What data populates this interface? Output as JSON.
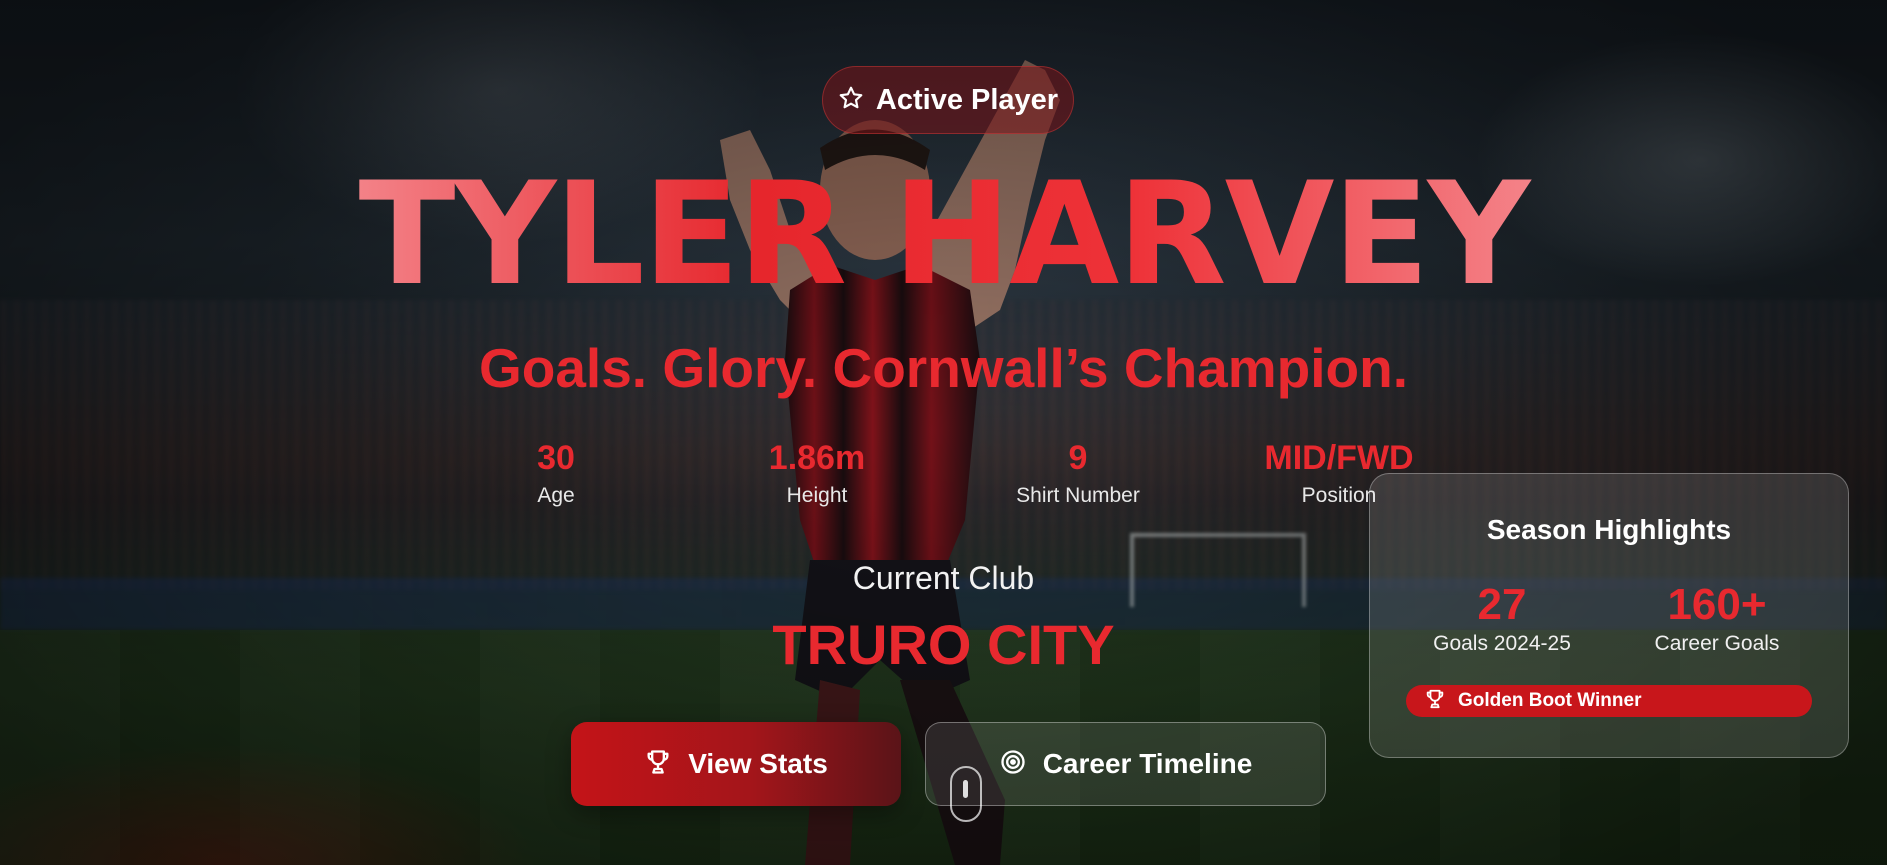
{
  "badge": {
    "label": "Active Player",
    "icon": "star-icon"
  },
  "hero": {
    "name": "TYLER HARVEY",
    "tagline": "Goals. Glory. Cornwall’s Champion."
  },
  "stats": [
    {
      "value": "30",
      "label": "Age"
    },
    {
      "value": "1.86m",
      "label": "Height"
    },
    {
      "value": "9",
      "label": "Shirt Number"
    },
    {
      "value": "MID/FWD",
      "label": "Position"
    }
  ],
  "club": {
    "label": "Current Club",
    "name": "TRURO CITY"
  },
  "buttons": {
    "view_stats": {
      "label": "View Stats",
      "icon": "trophy-icon"
    },
    "career_timeline": {
      "label": "Career Timeline",
      "icon": "target-icon"
    }
  },
  "highlights": {
    "title": "Season Highlights",
    "items": [
      {
        "value": "27",
        "label": "Goals 2024-25"
      },
      {
        "value": "160+",
        "label": "Career Goals"
      }
    ],
    "award": {
      "label": "Golden Boot Winner",
      "icon": "trophy-icon"
    }
  },
  "colors": {
    "accent": "#e8292f",
    "button_primary": "#c41418",
    "award_badge": "#c8161b"
  }
}
